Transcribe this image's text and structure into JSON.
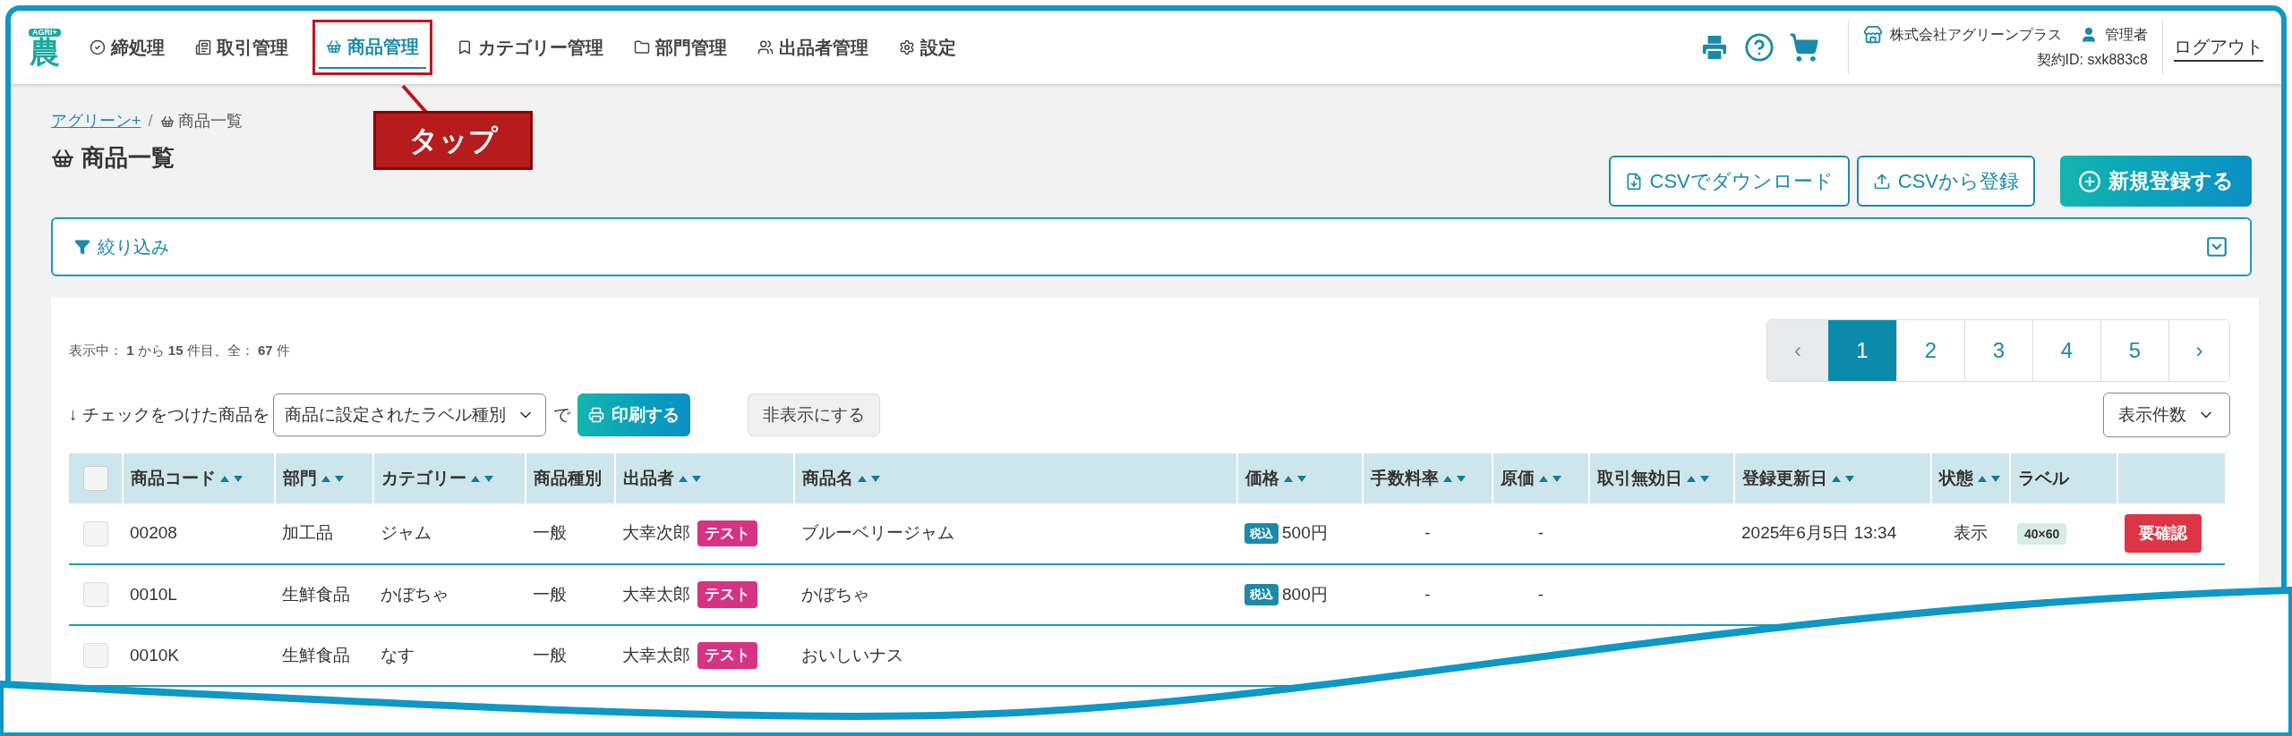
{
  "nav": {
    "logo": {
      "badge": "AGRI+",
      "glyph": "農"
    },
    "items": [
      {
        "label": "締処理",
        "selected": false
      },
      {
        "label": "取引管理",
        "selected": false
      },
      {
        "label": "商品管理",
        "selected": true
      },
      {
        "label": "カテゴリー管理",
        "selected": false
      },
      {
        "label": "部門管理",
        "selected": false
      },
      {
        "label": "出品者管理",
        "selected": false
      },
      {
        "label": "設定",
        "selected": false
      }
    ],
    "company": "株式会社アグリーンプラス",
    "user": "管理者",
    "contract": "契約ID: sxk883c8",
    "logout": "ログアウト"
  },
  "annotation": {
    "text": "タップ"
  },
  "breadcrumb_separator": "/",
  "breadcrumb": [
    {
      "label": "アグリーン+",
      "kind": "link"
    },
    {
      "label": "商品一覧",
      "kind": "current"
    }
  ],
  "title": "商品一覧",
  "actions": [
    {
      "label": "CSVでダウンロード",
      "kind": "download"
    },
    {
      "label": "CSVから登録",
      "kind": "upload"
    },
    {
      "label": "新規登録する",
      "kind": "primary"
    }
  ],
  "filter": {
    "label": "絞り込み"
  },
  "summary": "表示中： **1** から **15** 件目、全： **67** 件",
  "pagination": {
    "prev": "‹",
    "next": "›",
    "prev_disabled": true,
    "pages": [
      {
        "label": "1",
        "selected": true
      },
      {
        "label": "2",
        "selected": false
      },
      {
        "label": "3",
        "selected": false
      },
      {
        "label": "4",
        "selected": false
      },
      {
        "label": "5",
        "selected": false
      }
    ]
  },
  "bulk": {
    "prefix": "↓ チェックをつけた商品を",
    "select": "商品に設定されたラベル種別",
    "joiner": "で",
    "print": "印刷する",
    "hide": "非表示にする",
    "per_page": "表示件数"
  },
  "table": {
    "select_all_checked": false,
    "columns": [
      {
        "label": "商品コード",
        "sortable": true
      },
      {
        "label": "部門",
        "sortable": true
      },
      {
        "label": "カテゴリー",
        "sortable": true
      },
      {
        "label": "商品種別",
        "sortable": false
      },
      {
        "label": "出品者",
        "sortable": true
      },
      {
        "label": "商品名",
        "sortable": true
      },
      {
        "label": "価格",
        "sortable": true
      },
      {
        "label": "手数料率",
        "sortable": true
      },
      {
        "label": "原価",
        "sortable": true
      },
      {
        "label": "取引無効日",
        "sortable": true
      },
      {
        "label": "登録更新日",
        "sortable": true
      },
      {
        "label": "状態",
        "sortable": true
      },
      {
        "label": "ラベル",
        "sortable": false
      }
    ],
    "rows": [
      {
        "checked": false,
        "cells": [
          {
            "kind": "text",
            "text": "00208"
          },
          {
            "kind": "text",
            "text": "加工品"
          },
          {
            "kind": "text",
            "text": "ジャム"
          },
          {
            "kind": "text",
            "text": "一般"
          },
          {
            "kind": "seller",
            "text": "大幸次郎",
            "tag": "テスト"
          },
          {
            "kind": "text",
            "text": "ブルーベリージャム"
          },
          {
            "kind": "price",
            "tax": "税込",
            "text": "500円"
          },
          {
            "kind": "center",
            "text": "-"
          },
          {
            "kind": "center",
            "text": "-"
          },
          {
            "kind": "empty"
          },
          {
            "kind": "text",
            "text": "2025年6月5日 13:34"
          },
          {
            "kind": "center",
            "text": "表示"
          },
          {
            "kind": "label",
            "text": "40×60"
          },
          {
            "kind": "button",
            "text": "要確認"
          }
        ]
      },
      {
        "checked": false,
        "cells": [
          {
            "kind": "text",
            "text": "0010L"
          },
          {
            "kind": "text",
            "text": "生鮮食品"
          },
          {
            "kind": "text",
            "text": "かぼちゃ"
          },
          {
            "kind": "text",
            "text": "一般"
          },
          {
            "kind": "seller",
            "text": "大幸太郎",
            "tag": "テスト"
          },
          {
            "kind": "text",
            "text": "かぼちゃ"
          },
          {
            "kind": "price",
            "tax": "税込",
            "text": "800円"
          },
          {
            "kind": "center",
            "text": "-"
          },
          {
            "kind": "center",
            "text": "-"
          }
        ]
      },
      {
        "checked": false,
        "cells": [
          {
            "kind": "text",
            "text": "0010K"
          },
          {
            "kind": "text",
            "text": "生鮮食品"
          },
          {
            "kind": "text",
            "text": "なす"
          },
          {
            "kind": "text",
            "text": "一般"
          },
          {
            "kind": "seller",
            "text": "大幸太郎",
            "tag": "テスト"
          },
          {
            "kind": "text",
            "text": "おいしいナス"
          }
        ]
      }
    ]
  }
}
